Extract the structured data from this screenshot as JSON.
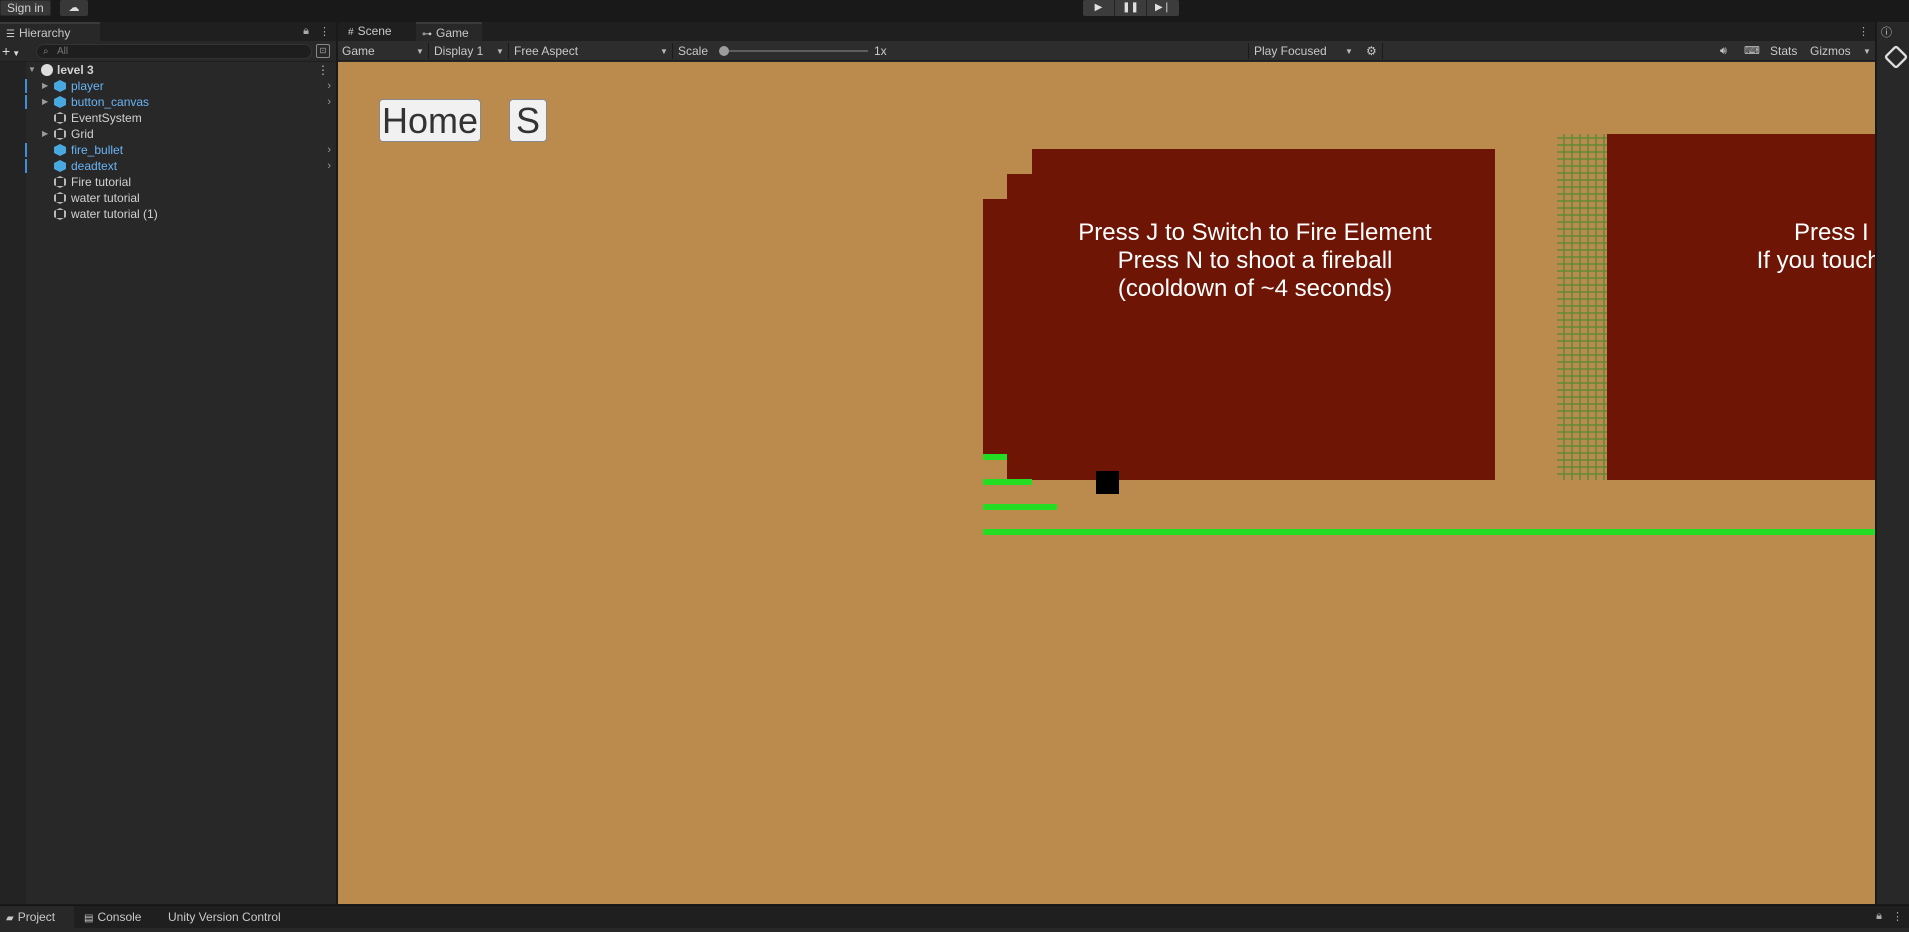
{
  "topbar": {
    "sign_in": "Sign in",
    "cloud_icon": "cloud-icon",
    "play_icon": "play-icon",
    "pause_icon": "pause-icon",
    "step_icon": "step-icon"
  },
  "hierarchy": {
    "tab_label": "Hierarchy",
    "search_placeholder": "All",
    "scene": "level 3",
    "items": [
      {
        "label": "player",
        "prefab": true,
        "expandable": true
      },
      {
        "label": "button_canvas",
        "prefab": true,
        "expandable": true
      },
      {
        "label": "EventSystem",
        "prefab": false,
        "expandable": false
      },
      {
        "label": "Grid",
        "prefab": false,
        "expandable": true
      },
      {
        "label": "fire_bullet",
        "prefab": true,
        "expandable": false
      },
      {
        "label": "deadtext",
        "prefab": true,
        "expandable": false
      },
      {
        "label": "Fire tutorial",
        "prefab": false,
        "expandable": false
      },
      {
        "label": "water tutorial",
        "prefab": false,
        "expandable": false
      },
      {
        "label": "water tutorial (1)",
        "prefab": false,
        "expandable": false
      }
    ]
  },
  "game": {
    "tabs": [
      "Scene",
      "Game"
    ],
    "active_tab": "Game",
    "toolbar": {
      "mode": "Game",
      "display": "Display 1",
      "aspect": "Free Aspect",
      "scale_label": "Scale",
      "scale_value": "1x",
      "play_mode": "Play Focused",
      "stats": "Stats",
      "gizmos": "Gizmos"
    },
    "ui_buttons": {
      "home": "Home",
      "s": "S"
    },
    "tutorial_fire": "Press J to Switch to Fire Element\nPress N to shoot a fireball\n(cooldown of ~4 seconds)",
    "tutorial_water": "Press I to S\nIf you touch wa",
    "colors": {
      "background": "#bb8b4e",
      "wall": "#6e1505",
      "grass": "#22dd22"
    }
  },
  "bottom": {
    "tabs": [
      "Project",
      "Console",
      "Unity Version Control"
    ],
    "active": "Project"
  }
}
